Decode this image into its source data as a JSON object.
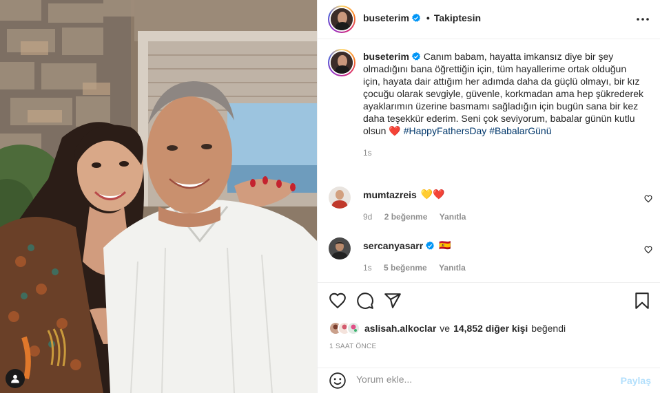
{
  "post": {
    "author": "buseterim",
    "follow_status": "Takiptesin",
    "dot": "•",
    "caption_text": "Canım babam, hayatta imkansız diye bir şey olmadığını bana öğrettiğin için, tüm hayallerime ortak olduğun için, hayata dair attığım her adımda daha da güçlü olmayı, bir kız çocuğu olarak sevgiyle, güvenle, korkmadan ama hep şükrederek ayaklarımın üzerine basmamı sağladığın için bugün sana bir kez daha teşekkür ederim. Seni çok seviyorum, babalar günün kutlu olsun",
    "caption_heart": "❤️",
    "hashtag_1": "#HappyFathersDay",
    "hashtag_2": "#BabalarGünü",
    "caption_time": "1s"
  },
  "comments": [
    {
      "username": "mumtazreis",
      "text": "💛❤️",
      "time": "9d",
      "likes": "2 beğenme",
      "reply": "Yanıtla"
    },
    {
      "username": "sercanyasarr",
      "text": "🇪🇸",
      "time": "1s",
      "likes": "5 beğenme",
      "reply": "Yanıtla"
    }
  ],
  "likes_line": {
    "liker": "aslisah.alkoclar",
    "connector": "ve",
    "count": "14,852 diğer kişi",
    "suffix": "beğendi"
  },
  "time_ago": "1 SAAT ÖNCE",
  "composer": {
    "placeholder": "Yorum ekle...",
    "share_label": "Paylaş"
  },
  "colors": {
    "link": "#00376b",
    "verified": "#0095f6",
    "muted": "#8e8e8e",
    "share_disabled": "#b2dffc",
    "heart": "#ed4956"
  },
  "icons": [
    "more-options-icon",
    "verified-badge-icon",
    "heart-icon",
    "comment-icon",
    "share-icon",
    "bookmark-icon",
    "emoji-icon",
    "user-tag-icon"
  ]
}
